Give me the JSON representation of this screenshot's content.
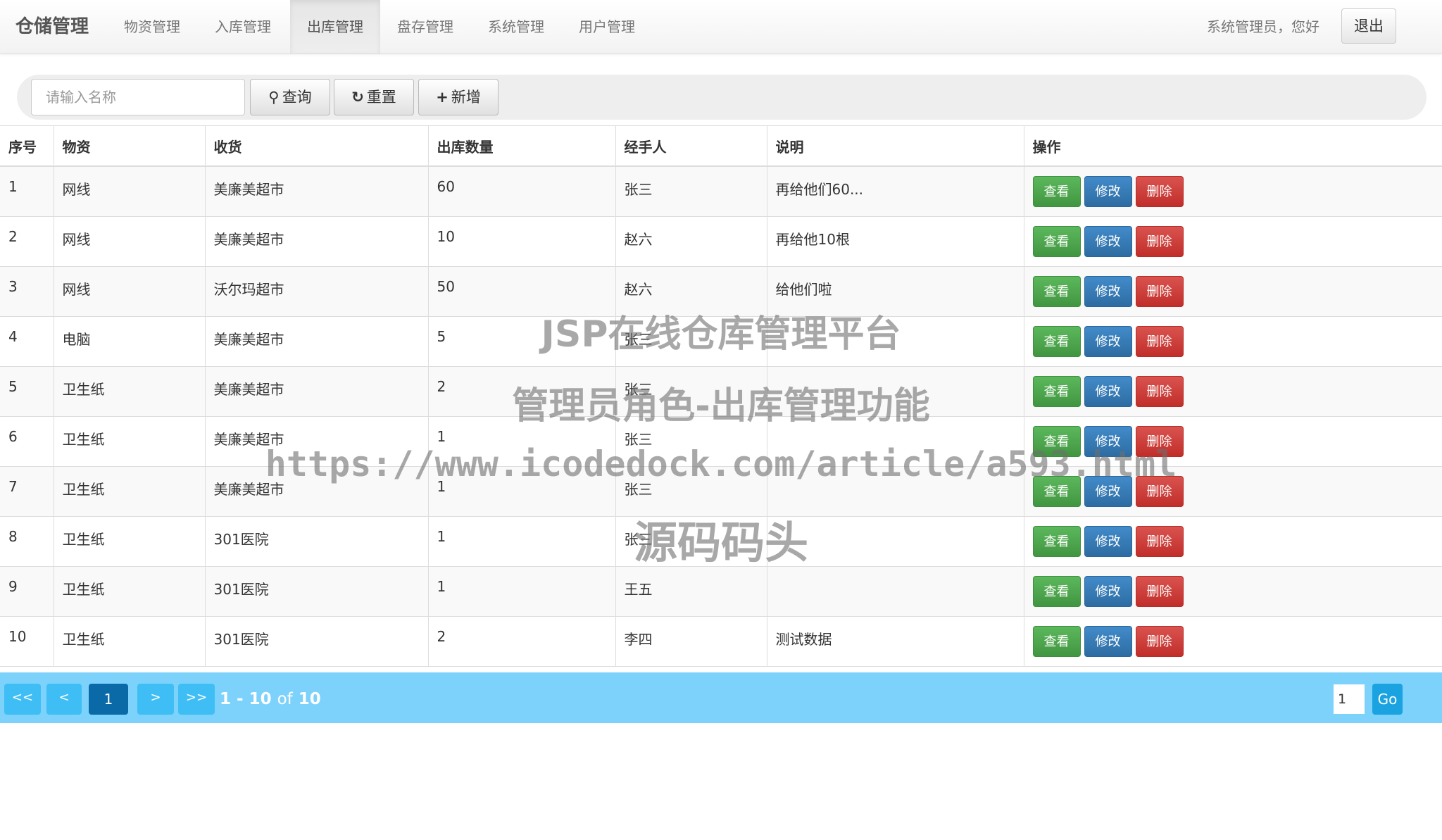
{
  "brand": "仓储管理",
  "nav": [
    "物资管理",
    "入库管理",
    "出库管理",
    "盘存管理",
    "系统管理",
    "用户管理"
  ],
  "greeting": "系统管理员，您好",
  "logout_label": "退出",
  "toolbar": {
    "search_placeholder": "请输入名称",
    "query_label": "查询",
    "reset_label": "重置",
    "add_label": "新增"
  },
  "table": {
    "headers": [
      "序号",
      "物资",
      "收货",
      "出库数量",
      "经手人",
      "说明",
      "操作"
    ],
    "rows": [
      {
        "no": "1",
        "item": "网线",
        "receiver": "美廉美超市",
        "qty": "60",
        "handler": "张三",
        "note": "再给他们60..."
      },
      {
        "no": "2",
        "item": "网线",
        "receiver": "美廉美超市",
        "qty": "10",
        "handler": "赵六",
        "note": "再给他10根"
      },
      {
        "no": "3",
        "item": "网线",
        "receiver": "沃尔玛超市",
        "qty": "50",
        "handler": "赵六",
        "note": "给他们啦"
      },
      {
        "no": "4",
        "item": "电脑",
        "receiver": "美廉美超市",
        "qty": "5",
        "handler": "张三",
        "note": ""
      },
      {
        "no": "5",
        "item": "卫生纸",
        "receiver": "美廉美超市",
        "qty": "2",
        "handler": "张三",
        "note": ""
      },
      {
        "no": "6",
        "item": "卫生纸",
        "receiver": "美廉美超市",
        "qty": "1",
        "handler": "张三",
        "note": ""
      },
      {
        "no": "7",
        "item": "卫生纸",
        "receiver": "美廉美超市",
        "qty": "1",
        "handler": "张三",
        "note": ""
      },
      {
        "no": "8",
        "item": "卫生纸",
        "receiver": "301医院",
        "qty": "1",
        "handler": "张三",
        "note": ""
      },
      {
        "no": "9",
        "item": "卫生纸",
        "receiver": "301医院",
        "qty": "1",
        "handler": "王五",
        "note": ""
      },
      {
        "no": "10",
        "item": "卫生纸",
        "receiver": "301医院",
        "qty": "2",
        "handler": "李四",
        "note": "测试数据"
      }
    ],
    "actions": {
      "view": "查看",
      "edit": "修改",
      "delete": "删除"
    }
  },
  "pager": {
    "first": "<<",
    "prev": "<",
    "current": "1",
    "next": ">",
    "last": ">>",
    "range": "1 - 10",
    "of": "of",
    "total": "10",
    "page_input": "1",
    "go_label": "Go"
  },
  "watermark": [
    "JSP在线仓库管理平台",
    "管理员角色-出库管理功能",
    "https://www.icodedock.com/article/a593.html",
    "源码码头"
  ],
  "colors": {
    "pager_bg": "#7dd2fb",
    "view_btn": "#5cb85c",
    "edit_btn": "#428bca",
    "delete_btn": "#d9534f"
  }
}
